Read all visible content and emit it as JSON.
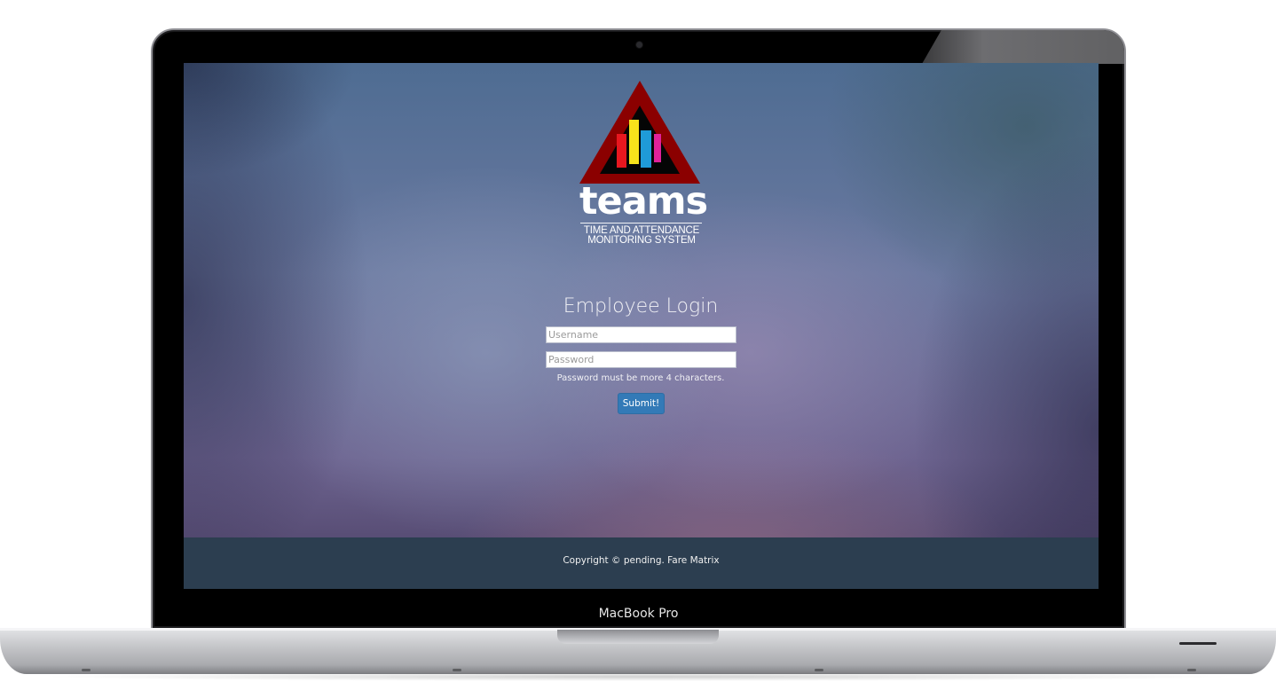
{
  "device": {
    "label": "MacBook Pro"
  },
  "logo": {
    "wordmark": "teams",
    "tagline_line1": "TIME AND ATTENDANCE",
    "tagline_line2": "MONITORING SYSTEM",
    "colors": {
      "triangle_outer": "#8b0000",
      "triangle_inner": "#000000",
      "bar_red": "#e8171f",
      "bar_yellow": "#f7e21b",
      "bar_blue": "#1f9bd8",
      "bar_magenta": "#e0219a"
    }
  },
  "login": {
    "title": "Employee Login",
    "username_placeholder": "Username",
    "password_placeholder": "Password",
    "hint": "Password must be more 4 characters.",
    "submit_label": "Submit!"
  },
  "footer": {
    "copyright": "Copyright © pending. Fare Matrix"
  },
  "colors": {
    "submit_bg": "#337ab7",
    "footer_bg": "#2c3e50"
  }
}
